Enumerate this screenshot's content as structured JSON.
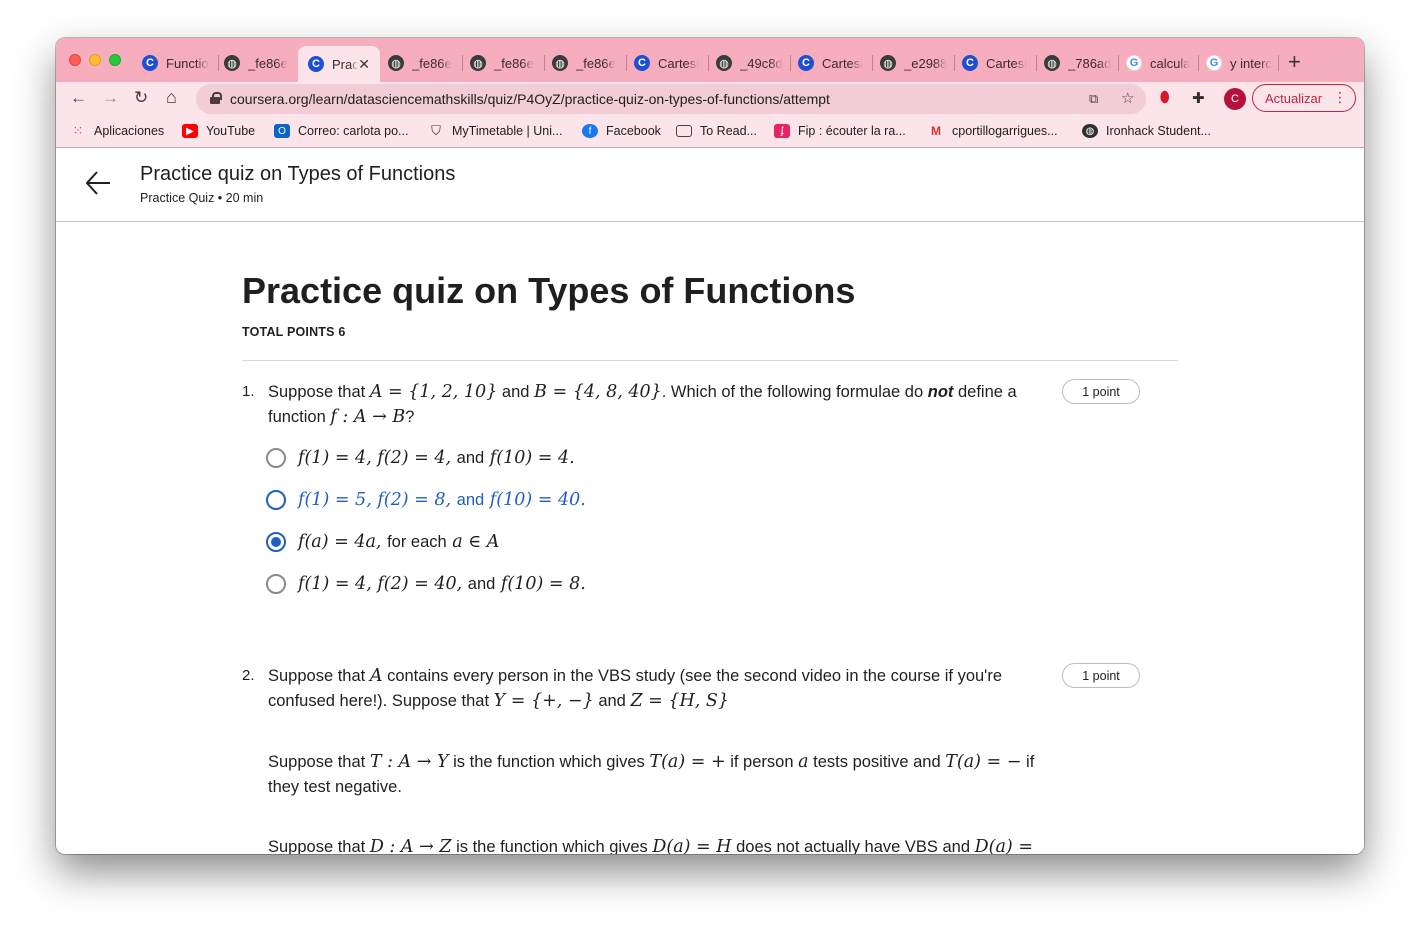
{
  "browser": {
    "tabs": [
      {
        "title": "Functio",
        "favicon": "coursera-icon"
      },
      {
        "title": "_fe86e",
        "favicon": "globe-icon"
      },
      {
        "title": "Prac",
        "favicon": "coursera-icon",
        "active": true
      },
      {
        "title": "_fe86e",
        "favicon": "globe-icon"
      },
      {
        "title": "_fe86e",
        "favicon": "globe-icon"
      },
      {
        "title": "_fe86e",
        "favicon": "globe-icon"
      },
      {
        "title": "Cartesi",
        "favicon": "coursera-icon"
      },
      {
        "title": "_49c8d",
        "favicon": "globe-icon"
      },
      {
        "title": "Cartesi",
        "favicon": "coursera-icon"
      },
      {
        "title": "_e2988",
        "favicon": "globe-icon"
      },
      {
        "title": "Cartesi",
        "favicon": "coursera-icon"
      },
      {
        "title": "_786ad",
        "favicon": "globe-icon"
      },
      {
        "title": "calcula",
        "favicon": "google-icon"
      },
      {
        "title": "y interc",
        "favicon": "google-icon"
      }
    ],
    "url": "coursera.org/learn/datasciencemathskills/quiz/P4OyZ/practice-quiz-on-types-of-functions/attempt",
    "profile_initial": "C",
    "update_label": "Actualizar",
    "bookmarks": [
      {
        "label": "Aplicaciones",
        "icon": "apps-grid-icon"
      },
      {
        "label": "YouTube",
        "icon": "youtube-icon"
      },
      {
        "label": "Correo: carlota po...",
        "icon": "outlook-icon"
      },
      {
        "label": "MyTimetable | Uni...",
        "icon": "shield-icon"
      },
      {
        "label": "Facebook",
        "icon": "facebook-icon"
      },
      {
        "label": "To Read...",
        "icon": "folder-icon"
      },
      {
        "label": "Fip : écouter la ra...",
        "icon": "radio-icon"
      },
      {
        "label": "cportillogarrigues...",
        "icon": "gmail-icon"
      },
      {
        "label": "Ironhack Student...",
        "icon": "globe-icon"
      }
    ]
  },
  "header": {
    "title": "Practice quiz on Types of Functions",
    "subtitle": "Practice Quiz • 20 min"
  },
  "quiz": {
    "title": "Practice quiz on Types of Functions",
    "total_points": "TOTAL POINTS 6",
    "questions": [
      {
        "number": "1.",
        "points": "1 point",
        "text_parts": [
          "Suppose that",
          "A = {1, 2, 10}",
          "and",
          "B = {4, 8, 40}",
          ". Which of the following formulae do",
          "not",
          "define a function",
          "f : A → B",
          "?"
        ],
        "options": [
          {
            "math_a": "f(1) = 4, f(2) = 4,",
            "word": "and",
            "math_b": "f(10) = 4.",
            "state": "unselected"
          },
          {
            "math_a": "f(1) = 5, f(2) = 8,",
            "word": "and",
            "math_b": "f(10) = 40.",
            "state": "hovered"
          },
          {
            "math_a": "f(a) = 4a,",
            "word": "for each",
            "math_b": "a ∈ A",
            "state": "selected"
          },
          {
            "math_a": "f(1) = 4, f(2) = 40,",
            "word": "and",
            "math_b": "f(10) = 8.",
            "state": "unselected"
          }
        ]
      },
      {
        "number": "2.",
        "points": "1 point",
        "text_parts": [
          "Suppose that",
          "A",
          "contains every person in the VBS study (see the second video in the course if you're confused here!). Suppose that",
          "Y = {+, −}",
          "and",
          "Z = {H, S}"
        ],
        "paragraph2_parts": [
          "Suppose that",
          "T : A → Y",
          "is the function which gives",
          "T(a) = +",
          "if person",
          "a",
          "tests positive and",
          "T(a) = −",
          "if they test negative."
        ],
        "paragraph3_parts": [
          "Suppose that",
          "D : A → Z",
          "is the function which gives",
          "D(a) = H",
          "does not actually have VBS and",
          "D(a) ="
        ]
      }
    ]
  }
}
